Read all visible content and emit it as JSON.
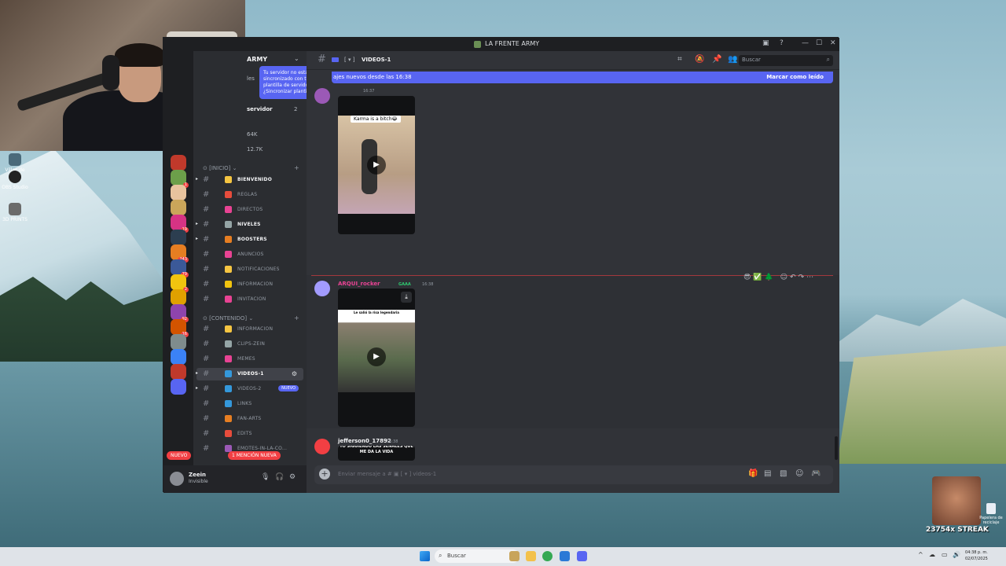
{
  "desktop": {
    "icons": [
      "Villas de Rio",
      "OBS Studio",
      "3D PRINTS"
    ],
    "recycle_bin": "Papelera de reciclaje",
    "streak": "23754x STREAK"
  },
  "window": {
    "title": "LA FRENTE ARMY"
  },
  "server": {
    "name": "ARMY",
    "tooltip": "Tu servidor no está sincronizado con tu plantilla de servidor. ¿Sincronizar plantilla?",
    "partial_label": "les",
    "boost_row": "servidor",
    "boost_count": "2",
    "member_stat_1": "64K",
    "member_stat_2": "12.7K"
  },
  "guild_badges": [
    "",
    "1",
    "",
    "",
    "19",
    "",
    "243",
    "79",
    "2",
    "",
    "92",
    "16",
    "",
    "",
    "",
    ""
  ],
  "categories": {
    "inicio": "[INICIO]",
    "contenido": "[CONTENIDO]"
  },
  "channels_inicio": [
    {
      "label": "BIENVENIDO",
      "emoji_color": "#f5c542",
      "unread": true
    },
    {
      "label": "REGLAS",
      "emoji_color": "#e74c3c",
      "unread": false
    },
    {
      "label": "DIRECTOS",
      "emoji_color": "#e84393",
      "unread": false
    },
    {
      "label": "NIVELES",
      "emoji_color": "#95a5a6",
      "unread": true
    },
    {
      "label": "BOOSTERS",
      "emoji_color": "#e67e22",
      "unread": true
    },
    {
      "label": "ANUNCIOS",
      "emoji_color": "#e84393",
      "unread": false
    },
    {
      "label": "NOTIFICACIONES",
      "emoji_color": "#f5c542",
      "unread": false
    },
    {
      "label": "INFORMACION",
      "emoji_color": "#f1c40f",
      "unread": false
    },
    {
      "label": "INVITACION",
      "emoji_color": "#e84393",
      "unread": false
    }
  ],
  "channels_contenido": [
    {
      "label": "INFORMACION",
      "emoji_color": "#f5c542"
    },
    {
      "label": "CLIPS-ZEIN",
      "emoji_color": "#95a5a6"
    },
    {
      "label": "MEMES",
      "emoji_color": "#e84393"
    },
    {
      "label": "VIDEOS-1",
      "emoji_color": "#3498db"
    },
    {
      "label": "VIDEOS-2",
      "emoji_color": "#3498db"
    },
    {
      "label": "LINKS",
      "emoji_color": "#3498db"
    },
    {
      "label": "FAN-ARTS",
      "emoji_color": "#e67e22"
    },
    {
      "label": "EDITS",
      "emoji_color": "#e74c3c"
    },
    {
      "label": "EMOTES-IN-LA-CO...",
      "emoji_color": "#9b59b6"
    }
  ],
  "badges": {
    "nuevo": "NUEVO",
    "mencion": "1 MENCIÓN NUEVA",
    "nuevo_left": "NUEVO"
  },
  "user": {
    "name": "Zeein",
    "status": "Invisible"
  },
  "header": {
    "channel_name": "VIDEOS-1",
    "search_placeholder": "Buscar"
  },
  "newbar": {
    "text": "ajes nuevos desde las 16:38",
    "mark_read": "Marcar como leído"
  },
  "messages": [
    {
      "author": "",
      "time": "16:37",
      "caption": "Karma is a bitch😂"
    },
    {
      "author": "ARQUI_rocker",
      "tag": "GAAA",
      "time": "16:38",
      "caption": "Le salió la risa legendaria"
    },
    {
      "author": "jefferson0_17892",
      "time": "16:38",
      "caption": "YO SIGUIENDO LAS SEÑALES QUE ME DA LA VIDA"
    }
  ],
  "composer": {
    "placeholder": "Enviar mensaje a #",
    "channel": "videos-1"
  },
  "taskbar": {
    "search": "Buscar",
    "time": "04:38 p. m.",
    "date": "02/07/2025"
  }
}
